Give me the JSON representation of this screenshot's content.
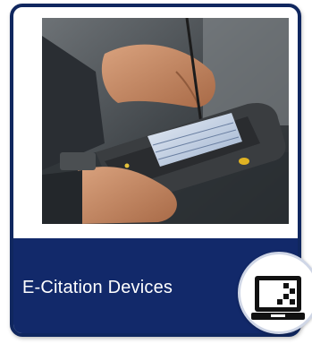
{
  "card": {
    "title": "E-Citation Devices",
    "photo_subject": "handheld-citation-device",
    "icon": "monitor-device-icon"
  },
  "colors": {
    "navy": "#12296a",
    "border": "#10275f",
    "white": "#ffffff"
  }
}
